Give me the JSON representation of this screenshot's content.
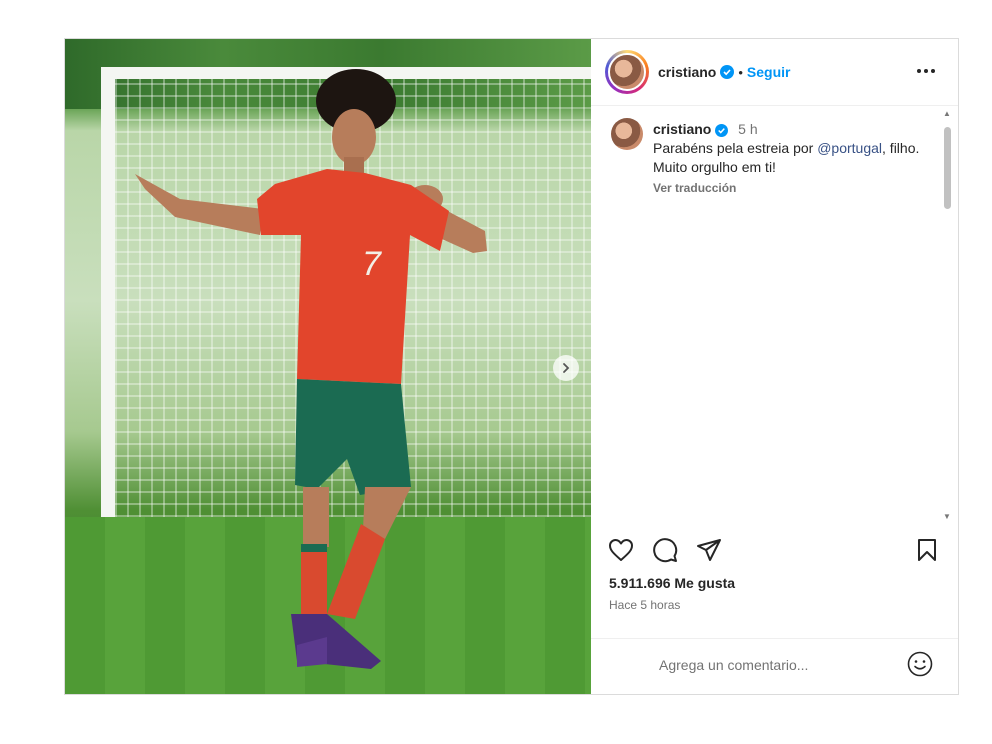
{
  "post": {
    "media": {
      "next_icon": "chevron-right-icon"
    },
    "header": {
      "username": "cristiano",
      "separator": "•",
      "follow_label": "Seguir",
      "more_icon": "more-horizontal-icon"
    },
    "caption": {
      "username": "cristiano",
      "time": "5 h",
      "text_before": "Parabéns pela estreia por ",
      "mention": "@portugal",
      "text_after": ", filho. Muito orgulho em ti!",
      "translate_label": "Ver traducción"
    },
    "actions": {
      "like_icon": "heart-icon",
      "comment_icon": "comment-icon",
      "share_icon": "send-icon",
      "save_icon": "bookmark-icon"
    },
    "likes_text": "5.911.696 Me gusta",
    "time_ago": "Hace 5 horas",
    "comment_box": {
      "placeholder": "Agrega un comentario...",
      "emoji_icon": "emoji-icon"
    },
    "colors": {
      "follow": "#0095f6",
      "mention": "#385185",
      "verified": "#0095f6"
    }
  }
}
